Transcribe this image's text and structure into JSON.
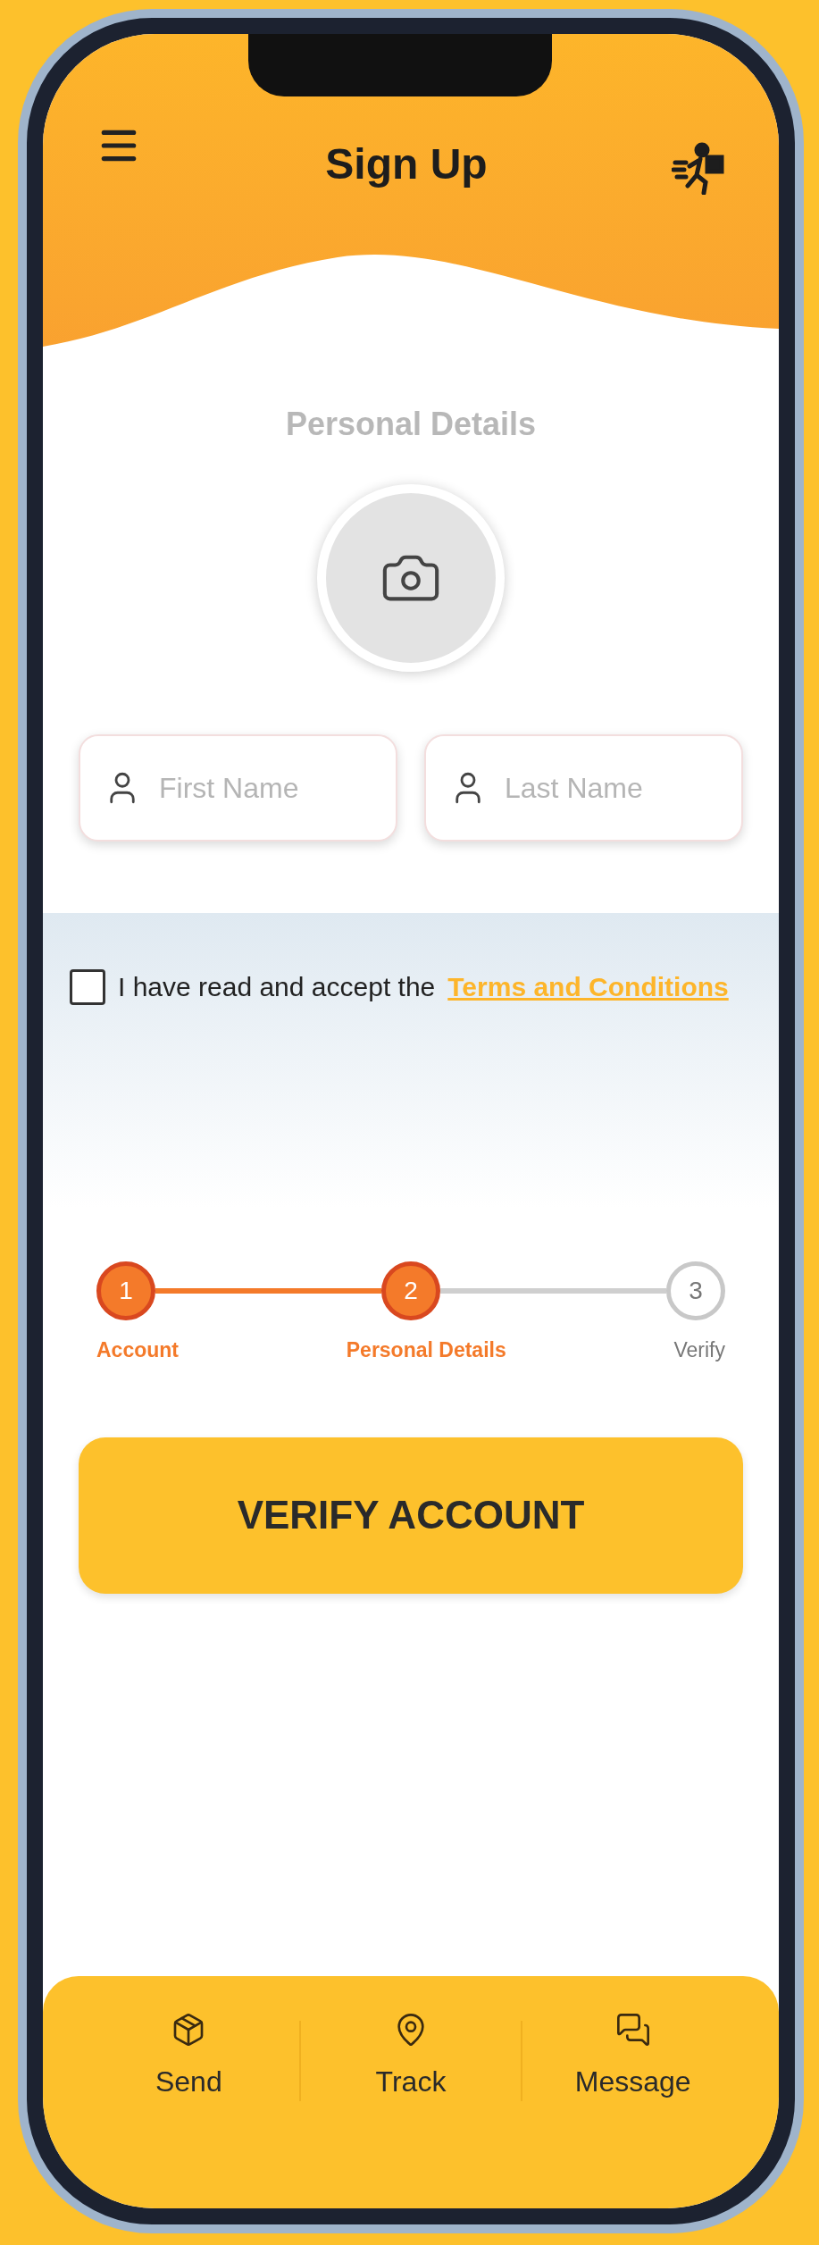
{
  "header": {
    "title": "Sign Up"
  },
  "section_title": "Personal Details",
  "fields": [
    {
      "placeholder": "First Name"
    },
    {
      "placeholder": "Last Name"
    }
  ],
  "terms": {
    "checked": false,
    "text": "I have read and accept the",
    "link": "Terms and Conditions"
  },
  "steps": [
    {
      "number": "1",
      "label": "Account",
      "active": true
    },
    {
      "number": "2",
      "label": "Personal Details",
      "active": true
    },
    {
      "number": "3",
      "label": "Verify",
      "active": false
    }
  ],
  "button": "VERIFY ACCOUNT",
  "nav": [
    {
      "label": "Send",
      "kind": "package"
    },
    {
      "label": "Track",
      "kind": "pin"
    },
    {
      "label": "Message",
      "kind": "chat"
    }
  ]
}
